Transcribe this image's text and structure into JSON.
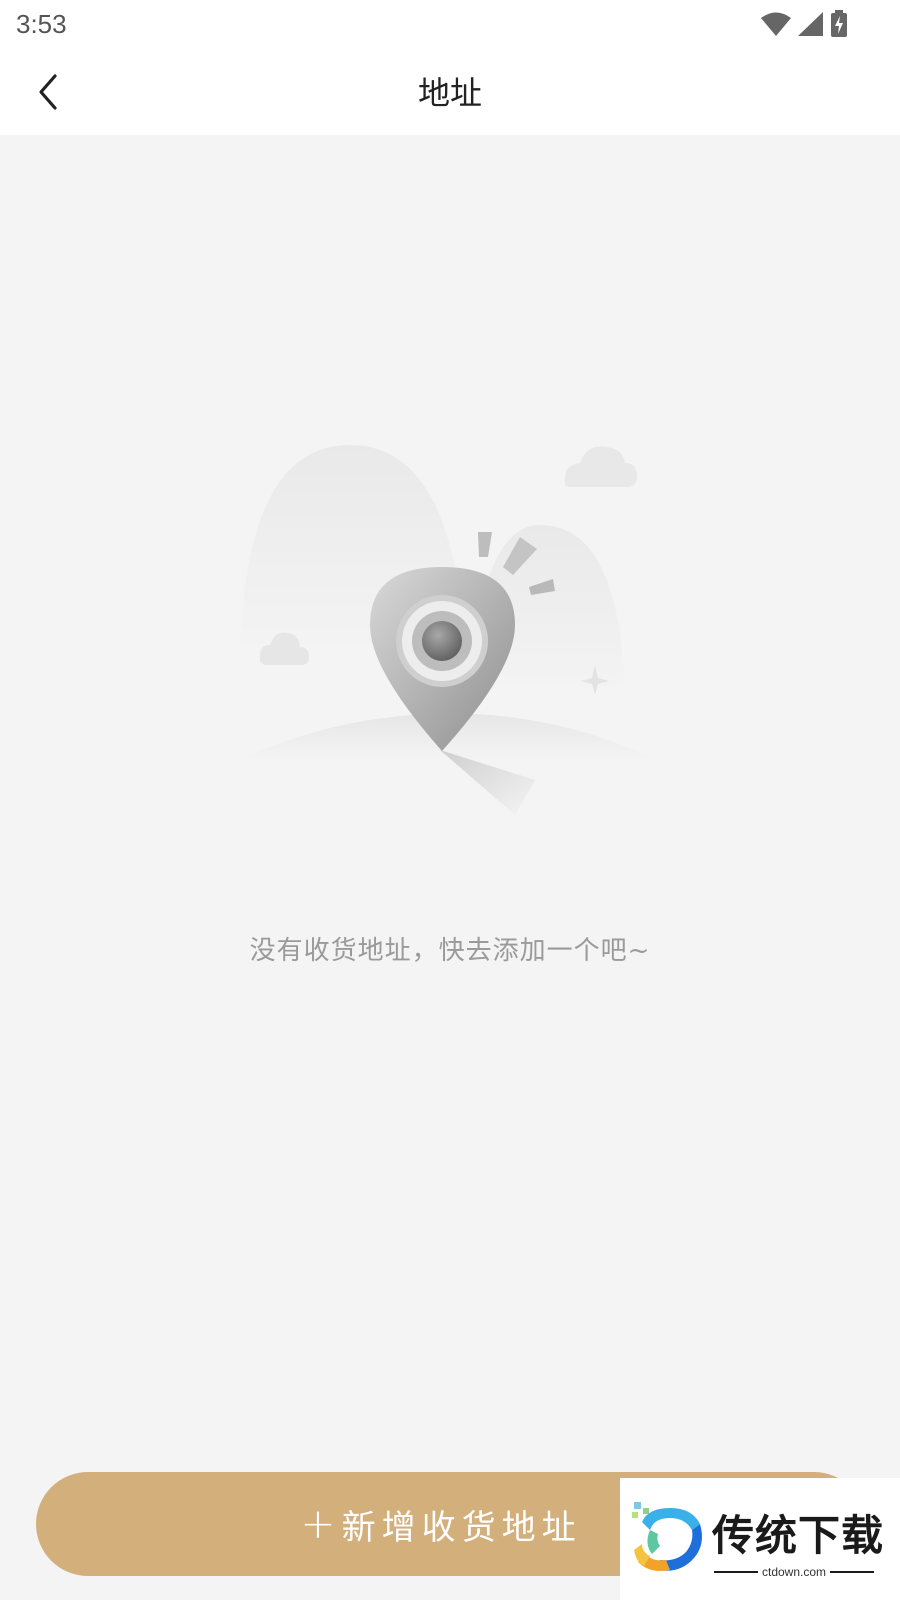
{
  "status_bar": {
    "time": "3:53",
    "icons": [
      "wifi-icon",
      "signal-icon",
      "battery-charging-icon"
    ]
  },
  "header": {
    "back_icon": "chevron-left-icon",
    "title": "地址"
  },
  "empty_state": {
    "illustration": "location-pin-illustration",
    "message": "没有收货地址，快去添加一个吧~"
  },
  "add_button": {
    "icon": "plus-icon",
    "plus": "+",
    "label": "新增收货地址",
    "color": "#d3af7c"
  },
  "watermark": {
    "title": "传统下载",
    "subtitle": "ctdown.com"
  }
}
